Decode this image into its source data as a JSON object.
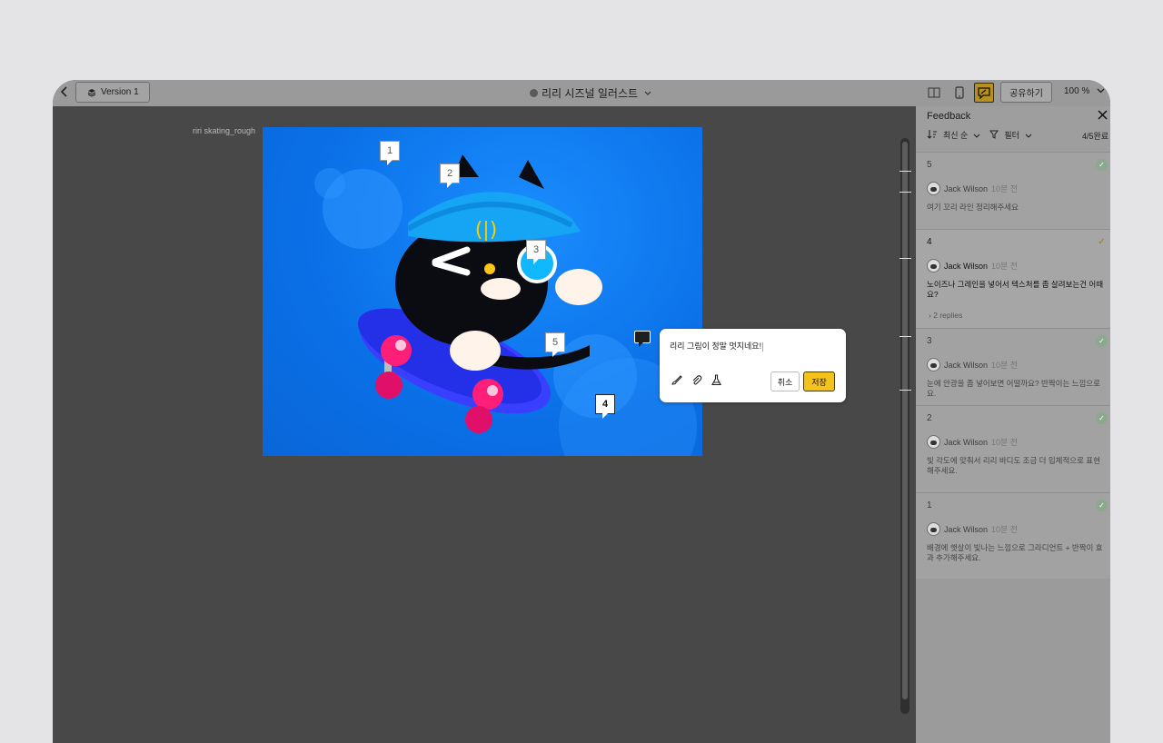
{
  "topbar": {
    "version_label": "Version 1",
    "doc_title": "리리 시즈널 일러스트",
    "share_label": "공유하기",
    "zoom": "100 %"
  },
  "canvas": {
    "artboard_label": "riri skating_rough",
    "pins": [
      "1",
      "2",
      "3",
      "5",
      "4"
    ]
  },
  "comment_box": {
    "text": "리리 그림이 정말 멋지네요!",
    "cancel_label": "취소",
    "save_label": "저장"
  },
  "panel": {
    "title": "Feedback",
    "sort_label": "최신 순",
    "filter_label": "필터",
    "progress": "4/5완료",
    "items": [
      {
        "num": "5",
        "author": "Jack Wilson",
        "time": "10분 전",
        "body": "여기 꼬리 라인 정리해주세요",
        "resolved": true
      },
      {
        "num": "4",
        "author": "Jack Wilson",
        "time": "10분 전",
        "body": "노이즈나 그레인을 넣어서 텍스처를 좀 살려보는건 어때요?",
        "replies": "2 replies",
        "resolved": false
      },
      {
        "num": "3",
        "author": "Jack Wilson",
        "time": "10분 전",
        "body": "눈에 안광을 좀 넣어보면 어떨까요? 반짝이는 느낌으로요.",
        "resolved": true
      },
      {
        "num": "2",
        "author": "Jack Wilson",
        "time": "10분 전",
        "body": "빛 각도에 맞춰서 리리 바디도 조금 더 입체적으로 표현해주세요.",
        "resolved": true
      },
      {
        "num": "1",
        "author": "Jack Wilson",
        "time": "10분 전",
        "body": "배경에 햇살이 빛나는 느낌으로 그라디언트 + 반짝이 효과 추가해주세요.",
        "resolved": true
      }
    ]
  },
  "colors": {
    "accent": "#f3c31c",
    "artboard_blue": "#0a6fe6",
    "canvas_bg": "#484848"
  }
}
